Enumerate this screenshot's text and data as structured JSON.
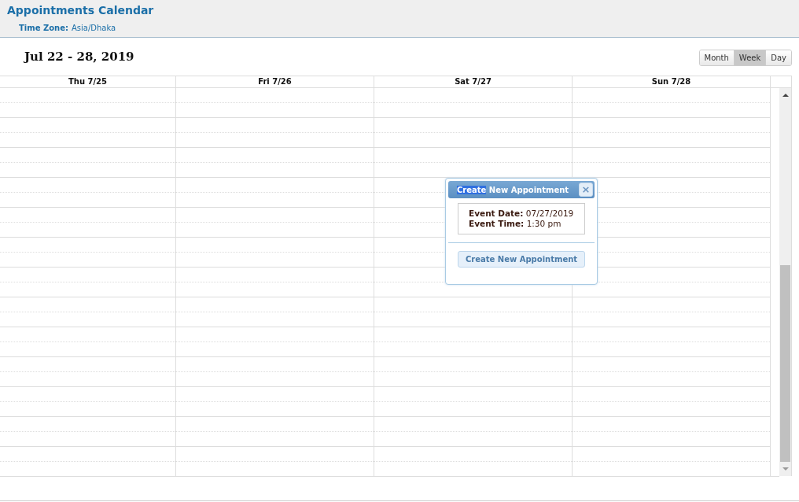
{
  "header": {
    "title": "Appointments Calendar",
    "time_zone_label": "Time Zone:",
    "time_zone": "Asia/Dhaka"
  },
  "range_title": "Jul 22 - 28, 2019",
  "views": [
    {
      "label": "Month",
      "selected": false
    },
    {
      "label": "Week",
      "selected": true
    },
    {
      "label": "Day",
      "selected": false
    }
  ],
  "columns": [
    "Thu 7/25",
    "Fri 7/26",
    "Sat 7/27",
    "Sun 7/28"
  ],
  "dialog": {
    "title_parts": [
      {
        "text": "Create",
        "selected": true
      },
      {
        "text": "New Appointment",
        "selected": false
      }
    ],
    "close": "×",
    "details": [
      "**Event Date:** 07/27/2019",
      "**Event Time:** 1:30 pm"
    ],
    "button": "Create New Appointment"
  }
}
